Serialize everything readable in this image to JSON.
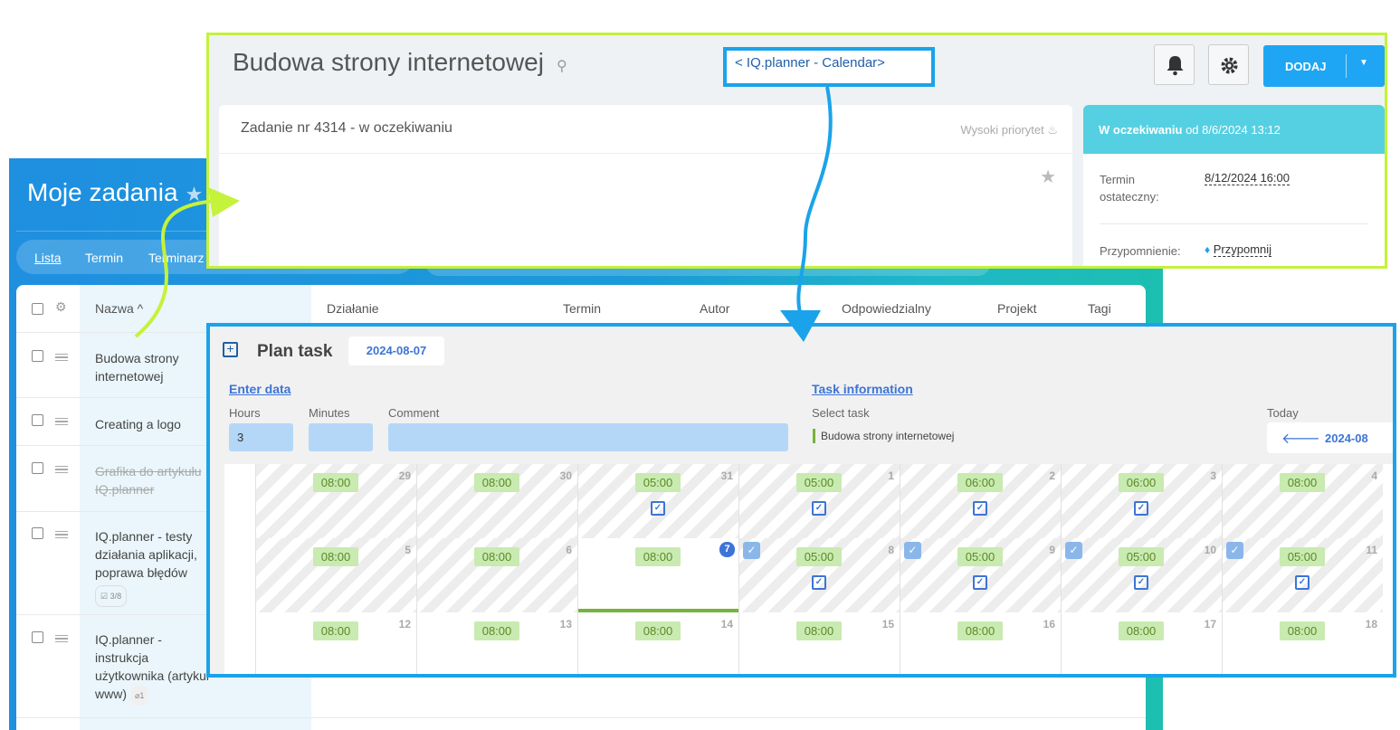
{
  "background_app": {
    "title": "Moje zadania",
    "tabs": [
      "Lista",
      "Termin",
      "Terminarz"
    ],
    "table_headers": [
      "Nazwa ^",
      "Działanie",
      "Termin",
      "Autor",
      "Odpowiedzialny",
      "Projekt",
      "Tagi"
    ],
    "tasks": [
      {
        "name": "Budowa strony internetowej"
      },
      {
        "name": "Creating a logo"
      },
      {
        "name": "Grafika do artykułu IQ.planner"
      },
      {
        "name": "IQ.planner - testy działania aplikacji, poprawa błędów",
        "badge": "☑ 3/8"
      },
      {
        "name": "IQ.planner - instrukcja użytkownika (artykuł www)",
        "badge": "1"
      }
    ]
  },
  "task_window": {
    "title": "Budowa strony internetowej",
    "calendar_link": "< IQ.planner - Calendar>",
    "add_button": "DODAJ",
    "subtitle": "Zadanie nr 4314 - w oczekiwaniu",
    "priority": "Wysoki priorytet",
    "status_bold": "W oczekiwaniu",
    "status_rest": " od 8/6/2024 13:12",
    "deadline_label": "Termin ostateczny:",
    "deadline_value": "8/12/2024 16:00",
    "reminder_label": "Przypomnienie:",
    "reminder_value": "Przypomnij"
  },
  "plan_window": {
    "title": "Plan task",
    "date": "2024-08-07",
    "enter_data": "Enter data",
    "task_information": "Task information",
    "hours_label": "Hours",
    "minutes_label": "Minutes",
    "comment_label": "Comment",
    "select_task_label": "Select task",
    "hours_value": "3",
    "minutes_value": "",
    "comment_value": "",
    "selected_task": "Budowa strony internetowej",
    "today_label": "Today",
    "month": "2024-08",
    "calendar": {
      "weeks": [
        [
          {
            "day": "29",
            "hours": "08:00"
          },
          {
            "day": "30",
            "hours": "08:00"
          },
          {
            "day": "31",
            "hours": "05:00",
            "planned": true
          },
          {
            "day": "1",
            "hours": "05:00",
            "planned": true
          },
          {
            "day": "2",
            "hours": "06:00",
            "planned": true
          },
          {
            "day": "3",
            "hours": "06:00",
            "planned": true
          },
          {
            "day": "4",
            "hours": "08:00"
          }
        ],
        [
          {
            "day": "5",
            "hours": "08:00"
          },
          {
            "day": "6",
            "hours": "08:00"
          },
          {
            "day": "7",
            "hours": "08:00",
            "today": true,
            "checked": true
          },
          {
            "day": "8",
            "hours": "05:00",
            "planned": true,
            "checked": true
          },
          {
            "day": "9",
            "hours": "05:00",
            "planned": true,
            "checked": true
          },
          {
            "day": "10",
            "hours": "05:00",
            "planned": true,
            "checked": true
          },
          {
            "day": "11",
            "hours": "05:00",
            "planned": true
          }
        ],
        [
          {
            "day": "12",
            "hours": "08:00"
          },
          {
            "day": "13",
            "hours": "08:00"
          },
          {
            "day": "14",
            "hours": "08:00"
          },
          {
            "day": "15",
            "hours": "08:00"
          },
          {
            "day": "16",
            "hours": "08:00"
          },
          {
            "day": "17",
            "hours": "08:00"
          },
          {
            "day": "18",
            "hours": "08:00"
          }
        ]
      ]
    }
  },
  "colors": {
    "green_frame": "#c5f23a",
    "blue_frame": "#1aa3ea",
    "accent_blue": "#3d74d6",
    "hours_chip": "#c9eab0"
  }
}
